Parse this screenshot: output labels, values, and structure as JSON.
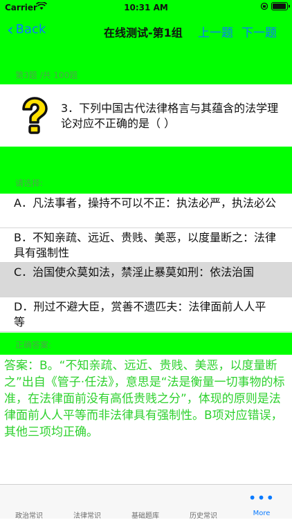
{
  "status_bar": {
    "carrier": "Carrier",
    "time": "10:31 AM"
  },
  "nav": {
    "back_label": "Back",
    "title": "在线测试-第1组",
    "prev_label": "上一题",
    "next_label": "下一题"
  },
  "progress": {
    "text": "第3题 /共 100题"
  },
  "question": {
    "text": "3．下列中国古代法律格言与其蕴含的法学理论对应不正确的是（ ）"
  },
  "choose_label": "请选择:",
  "options": [
    {
      "label": "A．凡法事者，操持不可以不正：执法必严，执法必公",
      "selected": false
    },
    {
      "label": "B．不知亲疏、远近、贵贱、美恶，以度量断之：法律具有强制性",
      "selected": false
    },
    {
      "label": "C．治国使众莫如法，禁淫止暴莫如刑：依法治国",
      "selected": true
    },
    {
      "label": "D．刑过不避大臣，赏善不遗匹夫：法律面前人人平等",
      "selected": false
    }
  ],
  "answer_label": "正确答案:",
  "explanation": "答案：B。“不知亲疏、远近、贵贱、美恶，以度量断之”出自《管子·任法》，意思是“法是衡量一切事物的标准，在法律面前没有高低贵贱之分”，体现的原则是法律面前人人平等而非法律具有强制性。B项对应错误，其他三项均正确。",
  "tabs": [
    {
      "label": "政治常识",
      "active": false
    },
    {
      "label": "法律常识",
      "active": false
    },
    {
      "label": "基础题库",
      "active": false
    },
    {
      "label": "历史常识",
      "active": false
    },
    {
      "label": "More",
      "active": true,
      "icon": "more-dots-icon"
    }
  ],
  "colors": {
    "accent": "#0a7aff",
    "header_green": "#00ff00",
    "answer_green": "#2ed12e"
  }
}
